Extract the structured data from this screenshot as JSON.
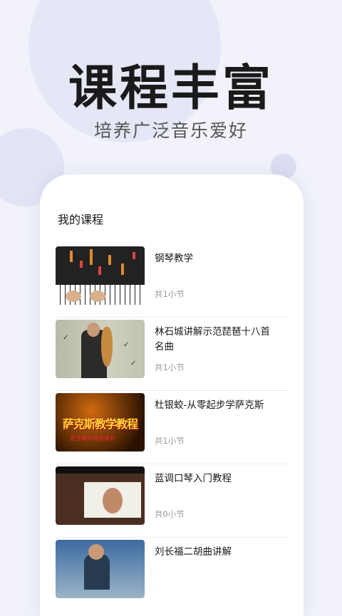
{
  "banner": {
    "headline": "课程丰富",
    "subheadline": "培养广泛音乐爱好"
  },
  "section": {
    "title": "我的课程"
  },
  "courses": [
    {
      "title": "钢琴教学",
      "count": "共1小节",
      "thumb_icon": "piano-lesson-thumbnail"
    },
    {
      "title": "林石城讲解示范琵琶十八首名曲",
      "count": "共1小节",
      "thumb_icon": "pipa-lesson-thumbnail"
    },
    {
      "title": "杜银蛟-从零起步学萨克斯",
      "count": "共1小节",
      "thumb_icon": "saxophone-lesson-thumbnail",
      "thumb_text": "萨克斯教学教程",
      "thumb_subtext": "更多精彩视频请到"
    },
    {
      "title": "蓝调口琴入门教程",
      "count": "共0小节",
      "thumb_icon": "harmonica-lesson-thumbnail"
    },
    {
      "title": "刘长福二胡曲讲解",
      "count": "",
      "thumb_icon": "erhu-lesson-thumbnail"
    }
  ]
}
